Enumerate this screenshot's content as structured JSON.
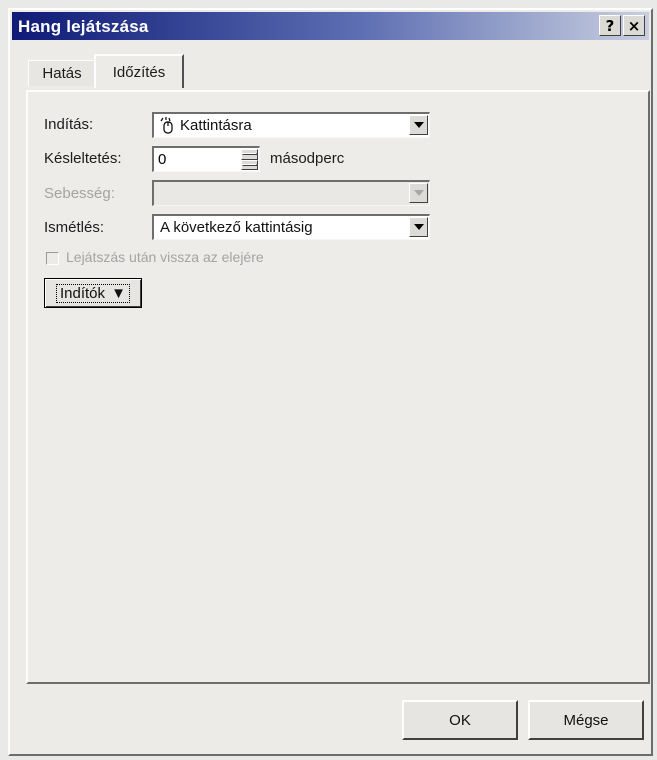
{
  "window": {
    "title": "Hang lejátszása",
    "help_label": "?",
    "close_label": "×"
  },
  "tabs": [
    {
      "label": "Hatás",
      "active": false
    },
    {
      "label": "Időzítés",
      "active": true
    }
  ],
  "fields": {
    "inditas": {
      "label": "Indítás:",
      "value": "Kattintásra",
      "icon": "mouse-click-icon"
    },
    "kesleltetes": {
      "label": "Késleltetés:",
      "value": "0",
      "unit": "másodperc"
    },
    "sebesseg": {
      "label": "Sebesség:",
      "value": "",
      "disabled": true
    },
    "ismetles": {
      "label": "Ismétlés:",
      "value": "A következő kattintásig"
    },
    "rewind": {
      "label": "Lejátszás után vissza az elejére",
      "checked": false,
      "disabled": true
    }
  },
  "buttons": {
    "triggers": "Indítók",
    "triggers_glyph": "↓↓",
    "ok": "OK",
    "cancel": "Mégse"
  }
}
